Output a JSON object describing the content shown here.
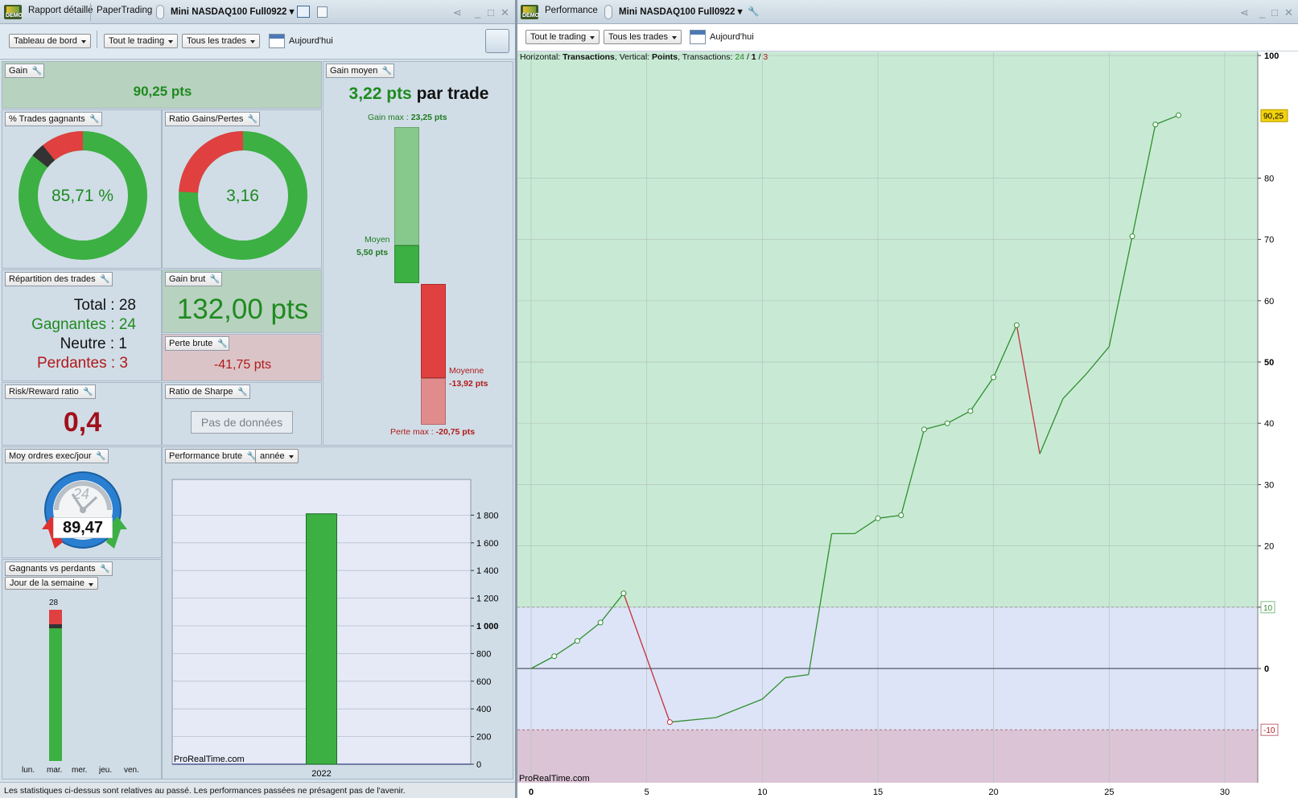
{
  "left_window": {
    "tab1": "Rapport détaillé",
    "tab2": "PaperTrading",
    "instrument": "Mini NASDAQ100 Full0922",
    "dashboard": "Tableau de bord",
    "filter_trading": "Tout le trading",
    "filter_trades": "Tous les trades",
    "date_label": "Aujourd'hui"
  },
  "right_window": {
    "title": "Performance",
    "instrument": "Mini NASDAQ100 Full0922",
    "filter_trading": "Tout le trading",
    "filter_trades": "Tous les trades",
    "date_label": "Aujourd'hui"
  },
  "demo_label": "DEMO",
  "panels": {
    "gain": {
      "title": "Gain",
      "value": "90,25 pts"
    },
    "gain_moyen": {
      "title": "Gain moyen",
      "value": "3,22 pts",
      "suffix": "par trade",
      "gain_max_label": "Gain max :",
      "gain_max": "23,25 pts",
      "moyen_label": "Moyen",
      "moyen_value": "5,50 pts",
      "moyenne_label": "Moyenne",
      "moyenne_value": "-13,92 pts",
      "perte_max_label": "Perte max :",
      "perte_max": "-20,75 pts"
    },
    "pct_gagnants": {
      "title": "% Trades gagnants",
      "value": "85,71 %",
      "win_pct": 85.71,
      "neutral_pct": 3.57,
      "loss_pct": 10.71
    },
    "ratio_gp": {
      "title": "Ratio Gains/Pertes",
      "value": "3,16",
      "gain_share": 75.97,
      "loss_share": 24.03
    },
    "repartition": {
      "title": "Répartition des trades",
      "total": "Total : 28",
      "gagnantes": "Gagnantes : 24",
      "neutre": "Neutre : 1",
      "perdantes": "Perdantes : 3"
    },
    "gain_brut": {
      "title": "Gain brut",
      "value": "132,00 pts"
    },
    "perte_brute": {
      "title": "Perte brute",
      "value": "-41,75 pts"
    },
    "risk_reward": {
      "title": "Risk/Reward ratio",
      "value": "0,4"
    },
    "sharpe": {
      "title": "Ratio de Sharpe",
      "value": "Pas de données"
    },
    "moy_ordres": {
      "title": "Moy ordres exec/jour",
      "value": "89,47",
      "dial": "24"
    },
    "perf_brute": {
      "title": "Performance brute",
      "period": "année",
      "watermark": "ProRealTime.com"
    },
    "gvp": {
      "title": "Gagnants vs perdants",
      "select": "Jour de la semaine",
      "top_label": "28",
      "days": [
        "lun.",
        "mar.",
        "mer.",
        "jeu.",
        "ven."
      ]
    }
  },
  "footer": "Les statistiques ci-dessus sont relatives au passé. Les performances passées ne présagent pas de l'avenir.",
  "perf_header": {
    "horizontal_label": "Horizontal:",
    "horizontal": "Transactions",
    "vertical_label": "Vertical:",
    "vertical": "Points",
    "transactions_label": "Transactions:",
    "win": "24",
    "sep1": " / ",
    "neutral": "1",
    "sep2": " / ",
    "loss": "3"
  },
  "perf_watermark": "ProRealTime.com",
  "perf_last_label": "90,25",
  "perf_line_10": "10",
  "perf_line_m10": "-10",
  "colors": {
    "win": "#2ca02c",
    "loss": "#d93a3a",
    "neutral": "#333333"
  },
  "chart_data": [
    {
      "type": "bar",
      "categories": [
        "2022"
      ],
      "values": [
        1810
      ],
      "ylim": [
        0,
        2000
      ],
      "yticks": [
        "0",
        "200",
        "400",
        "600",
        "800",
        "1 000",
        "1 200",
        "1 400",
        "1 600",
        "1 800"
      ],
      "ytick_values": [
        0,
        200,
        400,
        600,
        800,
        1000,
        1200,
        1400,
        1600,
        1800
      ]
    },
    {
      "type": "line",
      "xlabel": "Transactions",
      "ylabel": "Points",
      "x": [
        0,
        1,
        2,
        3,
        4,
        6,
        8,
        10,
        11,
        12,
        13,
        14,
        15,
        16,
        17,
        18,
        19,
        20,
        21,
        22,
        23,
        24,
        25,
        26,
        27,
        28
      ],
      "y": [
        0,
        2,
        4.5,
        7.5,
        12.25,
        -8.75,
        -8,
        -5,
        -1.5,
        -1,
        22,
        22,
        24.5,
        25,
        39,
        40,
        42,
        47.5,
        56,
        35,
        44,
        48,
        52.5,
        70.5,
        88.75,
        90.25
      ],
      "markers": [
        0,
        1,
        1,
        1,
        1,
        1,
        0,
        0,
        0,
        0,
        0,
        0,
        1,
        1,
        1,
        1,
        1,
        1,
        1,
        0,
        0,
        0,
        0,
        1,
        1,
        1
      ],
      "loss_segments": [
        [
          4,
          6
        ],
        [
          21,
          22
        ]
      ],
      "xlim": [
        0,
        30
      ],
      "ylim": [
        -18,
        100
      ],
      "xticks": [
        0,
        5,
        10,
        15,
        20,
        25,
        30
      ],
      "yticks": [
        0,
        10,
        20,
        30,
        40,
        50,
        60,
        70,
        80,
        100
      ]
    }
  ]
}
